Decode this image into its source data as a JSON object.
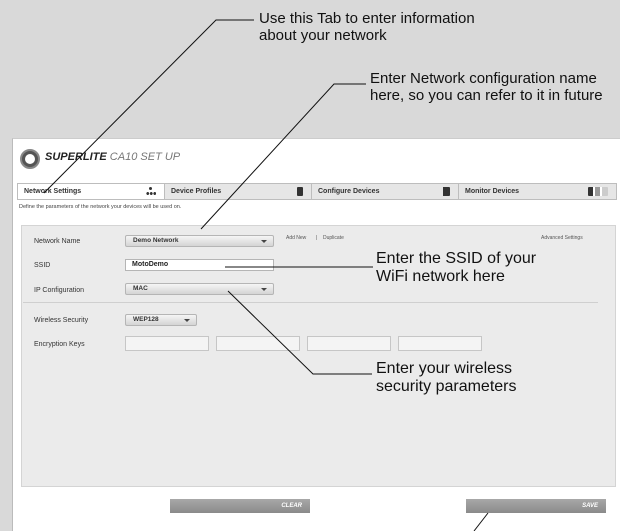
{
  "callouts": {
    "tab_info": [
      "Use this Tab to enter information",
      "about your network"
    ],
    "network_name": [
      "Enter Network configuration name",
      "here, so you can refer to it in future"
    ],
    "ssid": [
      "Enter the SSID of your",
      "WiFi network here"
    ],
    "security": [
      "Enter your wireless",
      "security parameters"
    ]
  },
  "app": {
    "title_brand": "SUPERLITE",
    "title_model": "CA10",
    "title_rest": "SET UP"
  },
  "tabs": [
    {
      "label": "Network Settings",
      "icon": "network-icon"
    },
    {
      "label": "Device Profiles",
      "icon": "device-icon"
    },
    {
      "label": "Configure Devices",
      "icon": "configure-icon"
    },
    {
      "label": "Monitor Devices",
      "icon": "monitor-icon"
    }
  ],
  "description": "Define the parameters of the network your devices will be used on.",
  "form": {
    "network_name_label": "Network Name",
    "network_name_value": "Demo Network",
    "add_new": "Add New",
    "separator": "|",
    "duplicate": "Duplicate",
    "advanced": "Advanced Settings",
    "ssid_label": "SSID",
    "ssid_value": "MotoDemo",
    "ip_label": "IP Configuration",
    "ip_value": "MAC",
    "security_label": "Wireless Security",
    "security_value": "WEP128",
    "keys_label": "Encryption Keys"
  },
  "buttons": {
    "clear": "CLEAR",
    "save": "SAVE"
  }
}
